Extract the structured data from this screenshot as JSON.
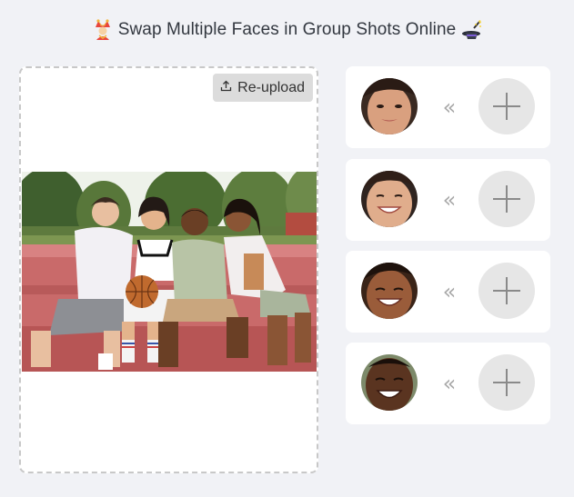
{
  "header": {
    "title": "Swap Multiple Faces in Group Shots Online",
    "left_icon": "jester-emoji-icon",
    "right_icon": "magic-hat-emoji-icon"
  },
  "upload": {
    "reupload_label": "Re-upload",
    "reupload_icon": "upload-icon",
    "photo_subject": "group-photo"
  },
  "faces": [
    {
      "avatar": "face-1-avatar",
      "arrow": "«",
      "action_icon": "plus-icon"
    },
    {
      "avatar": "face-2-avatar",
      "arrow": "«",
      "action_icon": "plus-icon"
    },
    {
      "avatar": "face-3-avatar",
      "arrow": "«",
      "action_icon": "plus-icon"
    },
    {
      "avatar": "face-4-avatar",
      "arrow": "«",
      "action_icon": "plus-icon"
    }
  ],
  "colors": {
    "background": "#f1f2f6",
    "card": "#ffffff",
    "button_gray": "#dcdcdc",
    "plus_bg": "#e6e6e6",
    "plus_stroke": "#8a8a8a",
    "chevron": "#a9a9a9"
  }
}
